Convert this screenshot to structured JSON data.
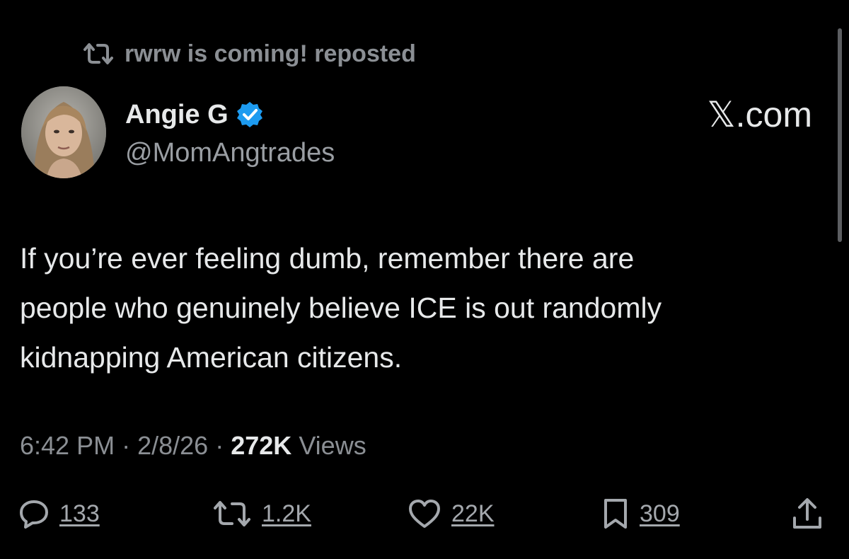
{
  "repost": {
    "label": "rwrw is coming! reposted",
    "icon": "repost-icon"
  },
  "author": {
    "display_name": "Angie G",
    "handle": "@MomAngtrades",
    "verified_icon": "verified-badge-icon",
    "verified_color": "#1d9bf0"
  },
  "source": {
    "label": "𝕏.com"
  },
  "tweet": {
    "lines": [
      "If you’re ever feeling dumb, remember there are",
      "people who genuinely believe ICE is out randomly",
      "kidnapping American citizens."
    ]
  },
  "meta": {
    "time": "6:42 PM",
    "sep1": "·",
    "date": "2/8/26",
    "sep2": "·",
    "views_count": "272K",
    "views_label": "Views"
  },
  "actions": {
    "replies": "133",
    "reposts": "1.2K",
    "likes": "22K",
    "bookmarks": "309"
  },
  "colors": {
    "background": "#000000",
    "primary_text": "#e7e9ea",
    "secondary_text": "#8b8f94"
  }
}
